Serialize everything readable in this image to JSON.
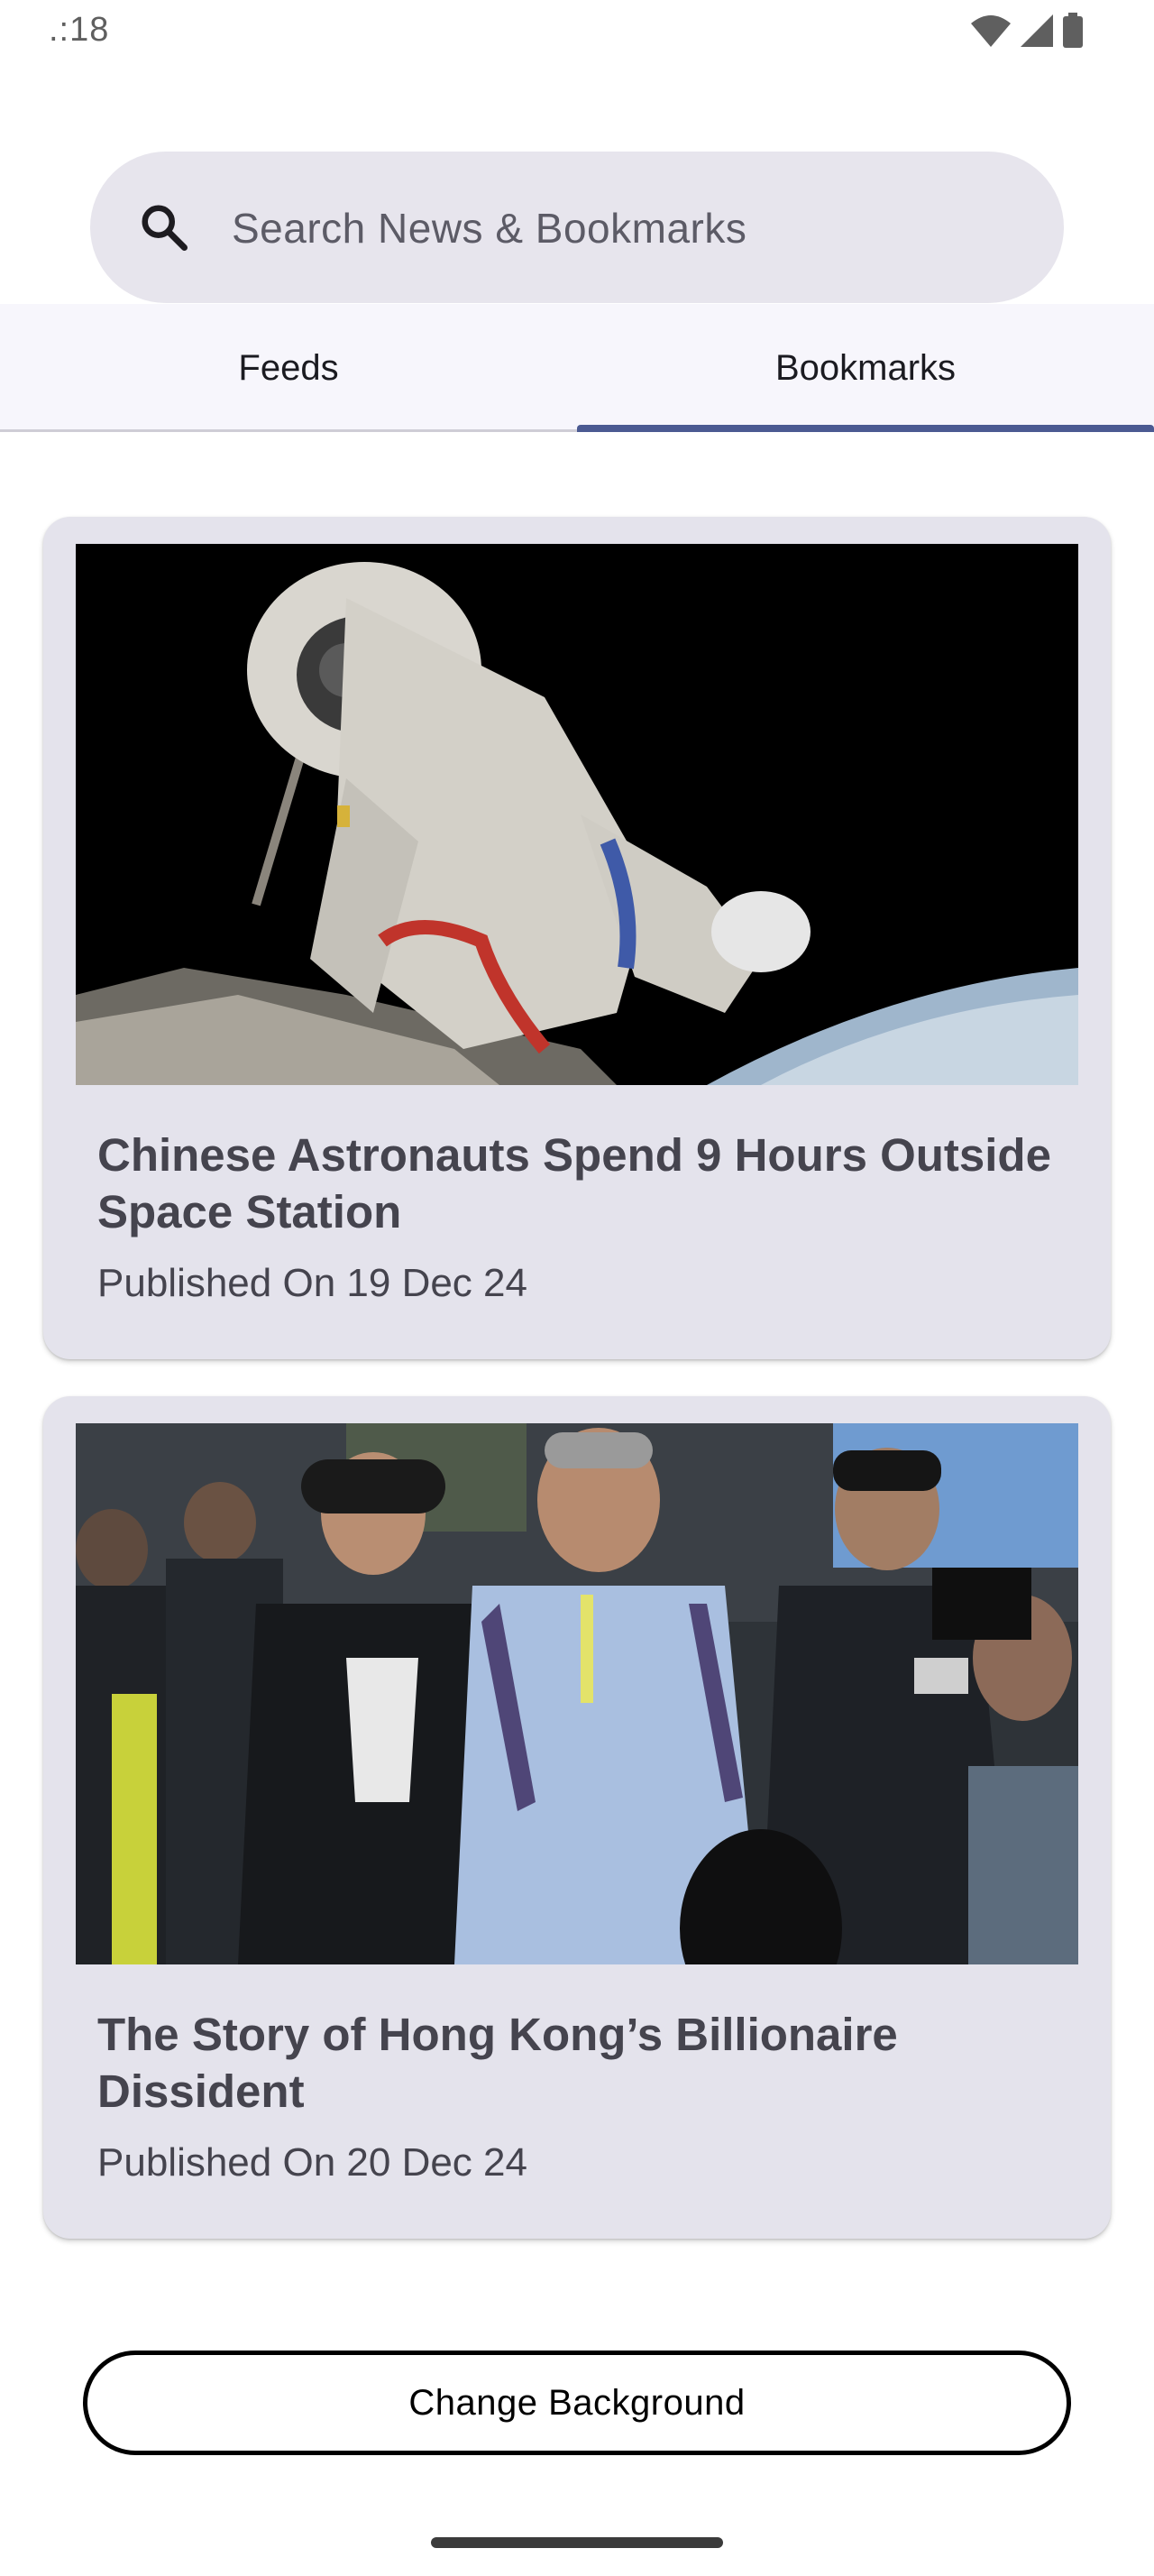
{
  "status_bar": {
    "time": ".:18",
    "icons": [
      "wifi-icon",
      "cellular-signal-icon",
      "battery-icon"
    ]
  },
  "search": {
    "placeholder": "Search News & Bookmarks",
    "value": "",
    "icon": "search-icon"
  },
  "tabs": [
    {
      "label": "Feeds",
      "selected": false
    },
    {
      "label": "Bookmarks",
      "selected": true
    }
  ],
  "bookmarks": [
    {
      "title": "Chinese Astronauts Spend 9 Hours Outside Space Station",
      "date": "Published On 19 Dec 24",
      "image": "astronaut-spacewalk-photo"
    },
    {
      "title": "The Story of Hong Kong’s Billionaire Dissident",
      "date": "Published On 20 Dec 24",
      "image": "hong-kong-crowd-photo"
    }
  ],
  "actions": {
    "change_background_label": "Change Background"
  },
  "colors": {
    "tab_indicator": "#4b5a92",
    "card_background": "#e4e3ec",
    "search_background": "#e7e5ed",
    "text": "#45444e"
  }
}
